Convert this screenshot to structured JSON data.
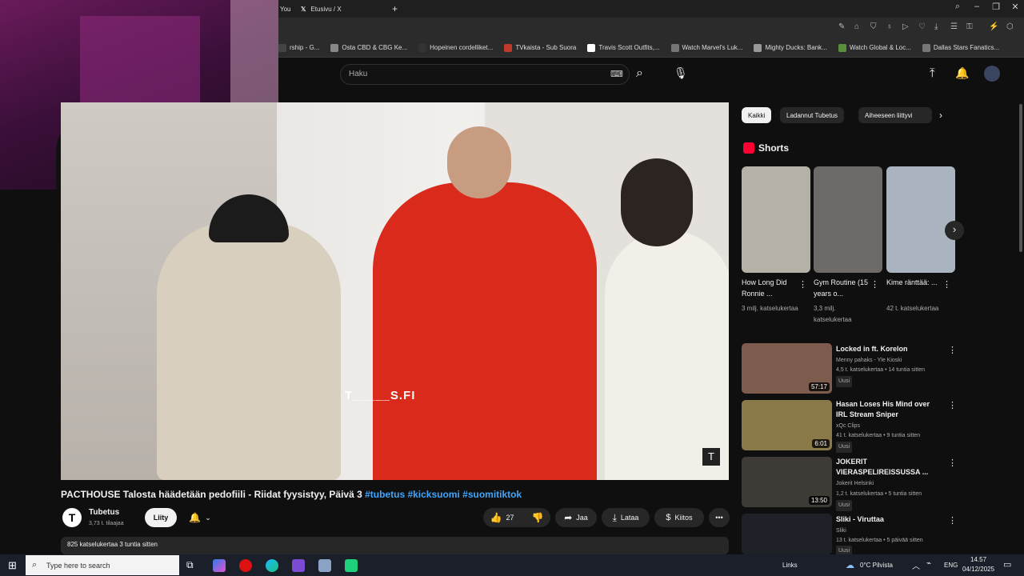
{
  "browser": {
    "tab_left": "You",
    "tab_active": "Etusivu / X",
    "bookmarks": [
      {
        "label": "rship - G...",
        "color": "#444"
      },
      {
        "label": "Osta CBD & CBG Ke...",
        "color": "#888"
      },
      {
        "label": "Hopeinen cordelliket...",
        "color": "#333"
      },
      {
        "label": "TVkaista - Sub Suora",
        "color": "#c0392b"
      },
      {
        "label": "Travis Scott Outfits,...",
        "color": "#ffffff"
      },
      {
        "label": "Watch Marvel's Luk...",
        "color": "#777"
      },
      {
        "label": "Mighty Ducks: Bank...",
        "color": "#999"
      },
      {
        "label": "Watch Global & Loc...",
        "color": "#5a8f3a"
      },
      {
        "label": "Dallas Stars Fanatics...",
        "color": "#777"
      }
    ]
  },
  "search": {
    "placeholder": "Haku"
  },
  "video": {
    "overlay_text": "T_____S.FI",
    "title_main": "PACTHOUSE Talosta häädetään pedofiili - Riidat fyysistyy, Päivä 3 ",
    "tags": "#tubetus #kicksuomi #suomitiktok",
    "channel_name": "Tubetus",
    "subscribers": "3,73 t. tilaajaa",
    "subscribe_label": "Liity",
    "likes": "27",
    "share_label": "Jaa",
    "download_label": "Lataa",
    "thanks_label": "Kiitos",
    "description_meta": "825 katselukertaa  3 tuntia sitten"
  },
  "chips": [
    "Kaikki",
    "Ladannut Tubetus",
    "Aiheeseen liittyvi"
  ],
  "shorts": {
    "heading": "Shorts",
    "items": [
      {
        "title": "How Long Did Ronnie ...",
        "views": "3 milj. katselukertaa",
        "color": "#b6b1a7"
      },
      {
        "title": "Gym Routine (15 years o...",
        "views": "3,3 milj. katselukertaa",
        "color": "#6e6a67"
      },
      {
        "title": "Kime ränttää: ...",
        "views": "42 t. katselukertaa",
        "color": "#a9b4c0"
      }
    ]
  },
  "related": [
    {
      "title": "Locked in ft. Korelon",
      "channel": "Menny pahaks - Yle Kioski",
      "meta": "4,5 t. katselukertaa • 14 tuntia sitten",
      "badge": "Uusi",
      "duration": "57:17",
      "color": "#7d5b4d"
    },
    {
      "title": "Hasan Loses His Mind over IRL Stream Sniper",
      "channel": "xQc Clips",
      "meta": "41 t. katselukertaa • 9 tuntia sitten",
      "badge": "Uusi",
      "duration": "6:01",
      "color": "#8a7a4a"
    },
    {
      "title": "JOKERIT VIERASPELIREISSUSSA ...",
      "channel": "Jokerit Helsinki",
      "meta": "1,2 t. katselukertaa • 5 tuntia sitten",
      "badge": "Uusi",
      "duration": "13:50",
      "color": "#3e3a36"
    },
    {
      "title": "Sliki - Viruttaa",
      "channel": "Sliki",
      "meta": "13 t. katselukertaa • 5 päivää sitten",
      "badge": "Uusi",
      "duration": "",
      "color": "#1e2228"
    }
  ],
  "taskbar": {
    "search_placeholder": "Type here to search",
    "links_label": "Links",
    "weather": "0°C  Pilvista",
    "lang": "ENG",
    "time": "14.57",
    "date": "04/12/2025"
  },
  "colors": {
    "accent_red": "#ff0033",
    "link_blue": "#3ea6ff"
  }
}
